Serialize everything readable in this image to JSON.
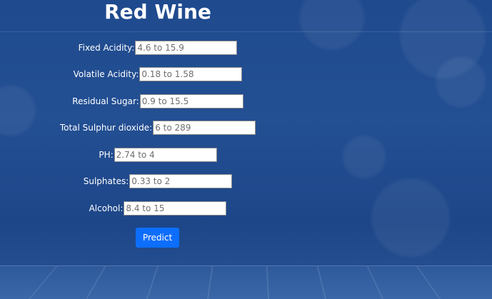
{
  "page": {
    "title": "Red Wine"
  },
  "form": {
    "fields": [
      {
        "label": "Fixed Acidity:",
        "placeholder": "4.6 to 15.9"
      },
      {
        "label": "Volatile Acidity:",
        "placeholder": "0.18 to 1.58"
      },
      {
        "label": "Residual Sugar:",
        "placeholder": "0.9 to 15.5"
      },
      {
        "label": "Total Sulphur dioxide:",
        "placeholder": "6 to 289"
      },
      {
        "label": "PH:",
        "placeholder": "2.74 to 4"
      },
      {
        "label": "Sulphates:",
        "placeholder": "0.33 to 2"
      },
      {
        "label": "Alcohol:",
        "placeholder": "8.4 to 15"
      }
    ],
    "submit_label": "Predict"
  },
  "colors": {
    "background": "#1f4a8e",
    "button": "#0d6efd"
  }
}
